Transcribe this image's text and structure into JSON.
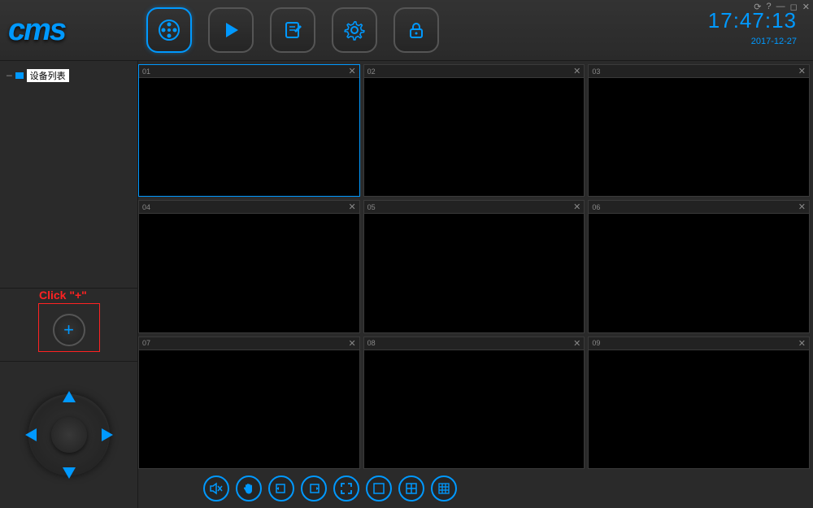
{
  "logo": "cms",
  "clock": {
    "time": "17:47:13",
    "date": "2017-12-27"
  },
  "win_controls": [
    "⟳",
    "?",
    "—",
    "◻",
    "✕"
  ],
  "toolbar": {
    "live": "live",
    "playback": "playback",
    "log": "log",
    "settings": "settings",
    "lock": "lock"
  },
  "sidebar": {
    "tree_root": "设备列表",
    "hint": "Click \"+\"",
    "add_label": "+"
  },
  "grid": {
    "selected": 0,
    "cells": [
      {
        "num": "01"
      },
      {
        "num": "02"
      },
      {
        "num": "03"
      },
      {
        "num": "04"
      },
      {
        "num": "05"
      },
      {
        "num": "06"
      },
      {
        "num": "07"
      },
      {
        "num": "08"
      },
      {
        "num": "09"
      }
    ]
  },
  "controls": {
    "mute": "mute",
    "hand": "hand",
    "prev": "prev",
    "next": "next",
    "fullscreen": "fullscreen",
    "layout1": "1x1",
    "layout4": "2x2",
    "layout9": "3x3"
  }
}
